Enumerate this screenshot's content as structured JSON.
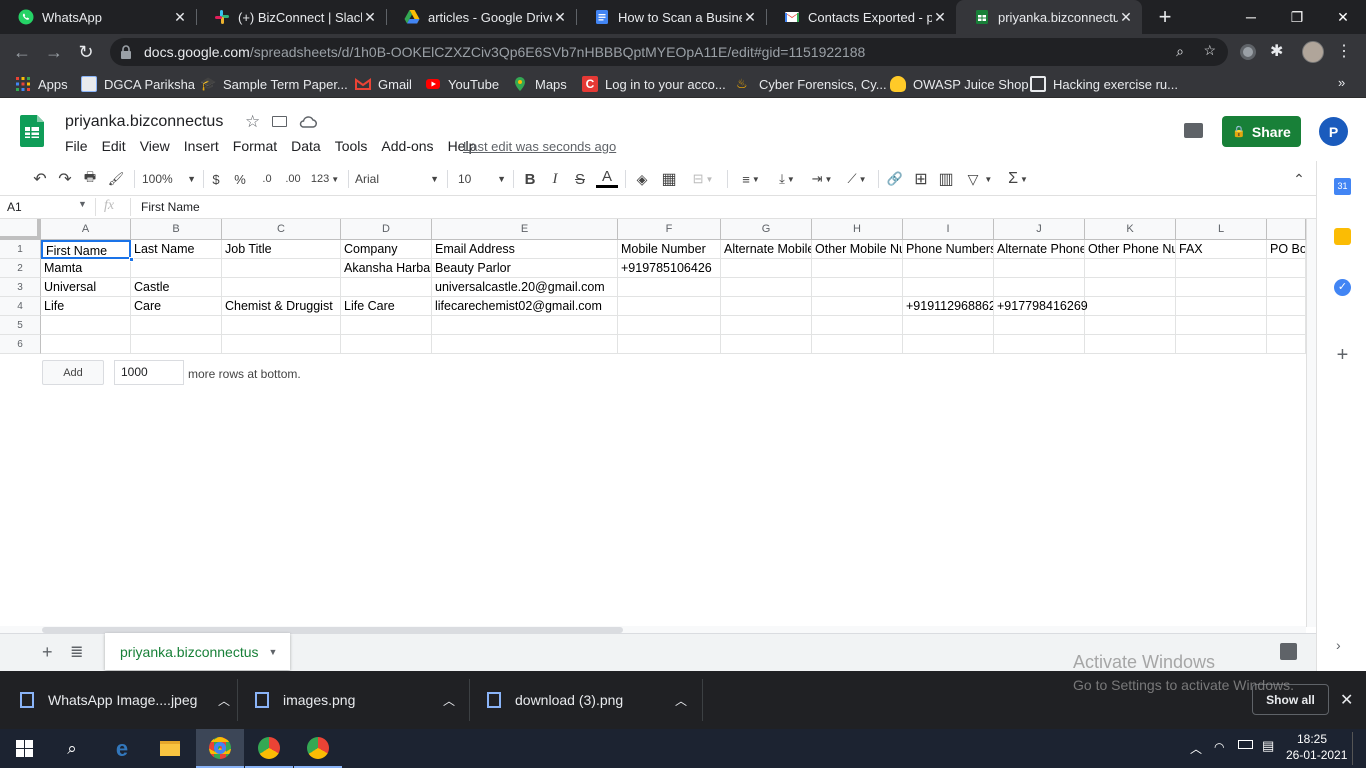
{
  "browser": {
    "tabs": [
      {
        "title": "WhatsApp",
        "icon": "whatsapp-icon",
        "color": "#25d366",
        "active": false
      },
      {
        "title": "(+) BizConnect | Slack",
        "icon": "slack-icon",
        "color": "#e01e5a",
        "active": false
      },
      {
        "title": "articles - Google Drive",
        "icon": "google-drive-icon",
        "color": "#fbbc04",
        "active": false
      },
      {
        "title": "How to Scan a Business",
        "icon": "google-docs-icon",
        "color": "#4285f4",
        "active": false
      },
      {
        "title": "Contacts Exported - pri",
        "icon": "gmail-icon",
        "color": "#ea4335",
        "active": false
      },
      {
        "title": "priyanka.bizconnectus -",
        "icon": "google-sheets-icon",
        "color": "#188038",
        "active": true
      }
    ],
    "url_host": "docs.google.com",
    "url_path": "/spreadsheets/d/1h0B-OOKElCZXZCiv3Qp6E6SVb7nHBBBQptMYEOpA11E/edit#gid=1151922188",
    "bookmarks": [
      {
        "label": "Apps",
        "icon": "apps-grid-icon",
        "color": "#ea4335"
      },
      {
        "label": "DGCA Pariksha",
        "icon": "dgca-icon",
        "color": "#8ab4f8"
      },
      {
        "label": "Sample Term Paper...",
        "icon": "graduation-cap-icon",
        "color": "#bdbdbd"
      },
      {
        "label": "Gmail",
        "icon": "gmail-icon",
        "color": "#ea4335"
      },
      {
        "label": "YouTube",
        "icon": "youtube-icon",
        "color": "#ff0000"
      },
      {
        "label": "Maps",
        "icon": "maps-icon",
        "color": "#34a853"
      },
      {
        "label": "Log in to your acco...",
        "icon": "c-logo-icon",
        "color": "#e53935"
      },
      {
        "label": "Cyber Forensics, Cy...",
        "icon": "flame-icon",
        "color": "#ffb300"
      },
      {
        "label": "OWASP Juice Shop",
        "icon": "juice-icon",
        "color": "#ffca28"
      },
      {
        "label": "Hacking exercise ru...",
        "icon": "book-icon",
        "color": "#e8eaed"
      }
    ]
  },
  "sheets": {
    "doc_title": "priyanka.bizconnectus",
    "menu": [
      "File",
      "Edit",
      "View",
      "Insert",
      "Format",
      "Data",
      "Tools",
      "Add-ons",
      "Help"
    ],
    "last_edit": "Last edit was seconds ago",
    "share_label": "Share",
    "avatar_letter": "P",
    "brand_color": "#188038",
    "toolbar": {
      "zoom": "100%",
      "currency": "$",
      "percent": "%",
      "dec_less": ".0",
      "dec_more": ".00",
      "more_formats": "123",
      "font": "Arial",
      "font_size": "10",
      "bold": "B",
      "italic": "I",
      "strike": "S",
      "text_color": "A"
    },
    "name_box": "A1",
    "fx_label": "fx",
    "formula": "First Name",
    "columns": [
      "A",
      "B",
      "C",
      "D",
      "E",
      "F",
      "G",
      "H",
      "I",
      "J",
      "K",
      "L",
      ""
    ],
    "rows": [
      [
        "First Name",
        "Last Name",
        "Job Title",
        "Company",
        "Email Address",
        "Mobile Number",
        "Alternate Mobile",
        "Other Mobile Nu",
        "Phone Numbers",
        "Alternate Phone",
        "Other Phone Nu",
        "FAX",
        "PO Bo"
      ],
      [
        "Mamta",
        "",
        "",
        "Akansha Harbal",
        "Beauty Parlor",
        "+919785106426",
        "",
        "",
        "",
        "",
        "",
        "",
        ""
      ],
      [
        "Universal",
        "Castle",
        "",
        "",
        "universalcastle.20@gmail.com",
        "",
        "",
        "",
        "",
        "",
        "",
        "",
        ""
      ],
      [
        "Life",
        "Care",
        "Chemist & Druggist",
        "Life Care",
        "lifecarechemist02@gmail.com",
        "",
        "",
        "",
        "+919112968862",
        "+917798416269",
        "",
        "",
        ""
      ],
      [
        "",
        "",
        "",
        "",
        "",
        "",
        "",
        "",
        "",
        "",
        "",
        "",
        ""
      ],
      [
        "",
        "",
        "",
        "",
        "",
        "",
        "",
        "",
        "",
        "",
        "",
        "",
        ""
      ]
    ],
    "row_numbers": [
      "1",
      "2",
      "3",
      "4",
      "5",
      "6"
    ],
    "add_button": "Add",
    "add_count": "1000",
    "add_text": "more rows at bottom.",
    "sheet_tab": "priyanka.bizconnectus"
  },
  "activate_windows": {
    "title": "Activate Windows",
    "subtitle": "Go to Settings to activate Windows."
  },
  "downloads": {
    "items": [
      "WhatsApp Image....jpeg",
      "images.png",
      "download (3).png"
    ],
    "show_all": "Show all"
  },
  "taskbar": {
    "time": "18:25",
    "date": "26-01-2021"
  }
}
